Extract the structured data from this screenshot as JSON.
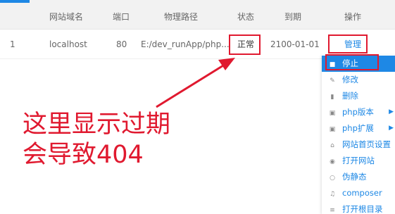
{
  "table": {
    "headers": [
      "网站域名",
      "端口",
      "物理路径",
      "状态",
      "到期",
      "操作"
    ],
    "row": {
      "index": "1",
      "domain": "localhost",
      "port": "80",
      "path": "E:/dev_runApp/php...",
      "status": "正常",
      "expire": "2100-01-01",
      "action": "管理"
    }
  },
  "menu": {
    "items": [
      {
        "label": "停止",
        "icon": "stop-icon"
      },
      {
        "label": "修改",
        "icon": "edit-icon"
      },
      {
        "label": "删除",
        "icon": "trash-icon"
      },
      {
        "label": "php版本",
        "icon": "php-version-icon"
      },
      {
        "label": "php扩展",
        "icon": "php-extension-icon"
      },
      {
        "label": "网站首页设置",
        "icon": "home-icon"
      },
      {
        "label": "打开网站",
        "icon": "globe-icon"
      },
      {
        "label": "伪静态",
        "icon": "rewrite-icon"
      },
      {
        "label": "composer",
        "icon": "composer-icon"
      },
      {
        "label": "打开根目录",
        "icon": "folder-icon"
      }
    ]
  },
  "annotation": {
    "line1": "这里显示过期",
    "line2": "会导致404"
  },
  "colors": {
    "accent": "#1e88e5",
    "annotation": "#e0192f"
  }
}
